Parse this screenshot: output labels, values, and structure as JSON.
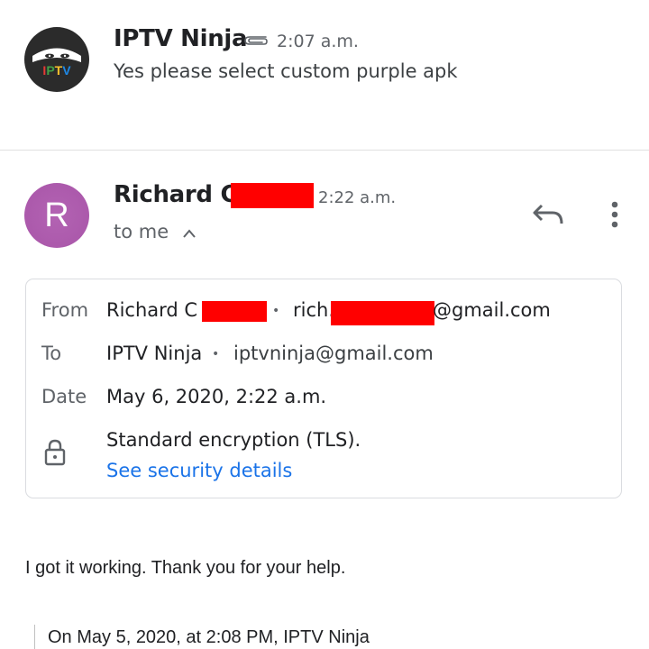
{
  "thread": [
    {
      "sender": "IPTV Ninja",
      "avatar_text": "IPTV",
      "has_attachment": true,
      "time": "2:07 a.m.",
      "snippet": "Yes please select custom purple apk"
    },
    {
      "sender": "Richard C",
      "avatar_letter": "R",
      "avatar_color": "#a855a8",
      "time": "2:22 a.m.",
      "recipient_line": "to me",
      "details": {
        "from_label": "From",
        "from_name": "Richard C",
        "from_email_prefix": "rich.",
        "from_email_suffix": "@gmail.com",
        "to_label": "To",
        "to_name": "IPTV Ninja",
        "to_email": "iptvninja@gmail.com",
        "date_label": "Date",
        "date_value": "May 6, 2020, 2:22 a.m.",
        "encryption_text": "Standard encryption (TLS).",
        "security_link": "See security details"
      },
      "body": "I got it working.  Thank you for your help.",
      "quoted_header": "On May 5, 2020, at 2:08 PM, IPTV Ninja"
    }
  ],
  "separator": "•",
  "colors": {
    "link": "#1a73e8",
    "redaction": "#ff0000"
  },
  "icons": [
    "attachment-icon",
    "chevron-up-icon",
    "reply-icon",
    "more-vert-icon",
    "lock-icon"
  ]
}
